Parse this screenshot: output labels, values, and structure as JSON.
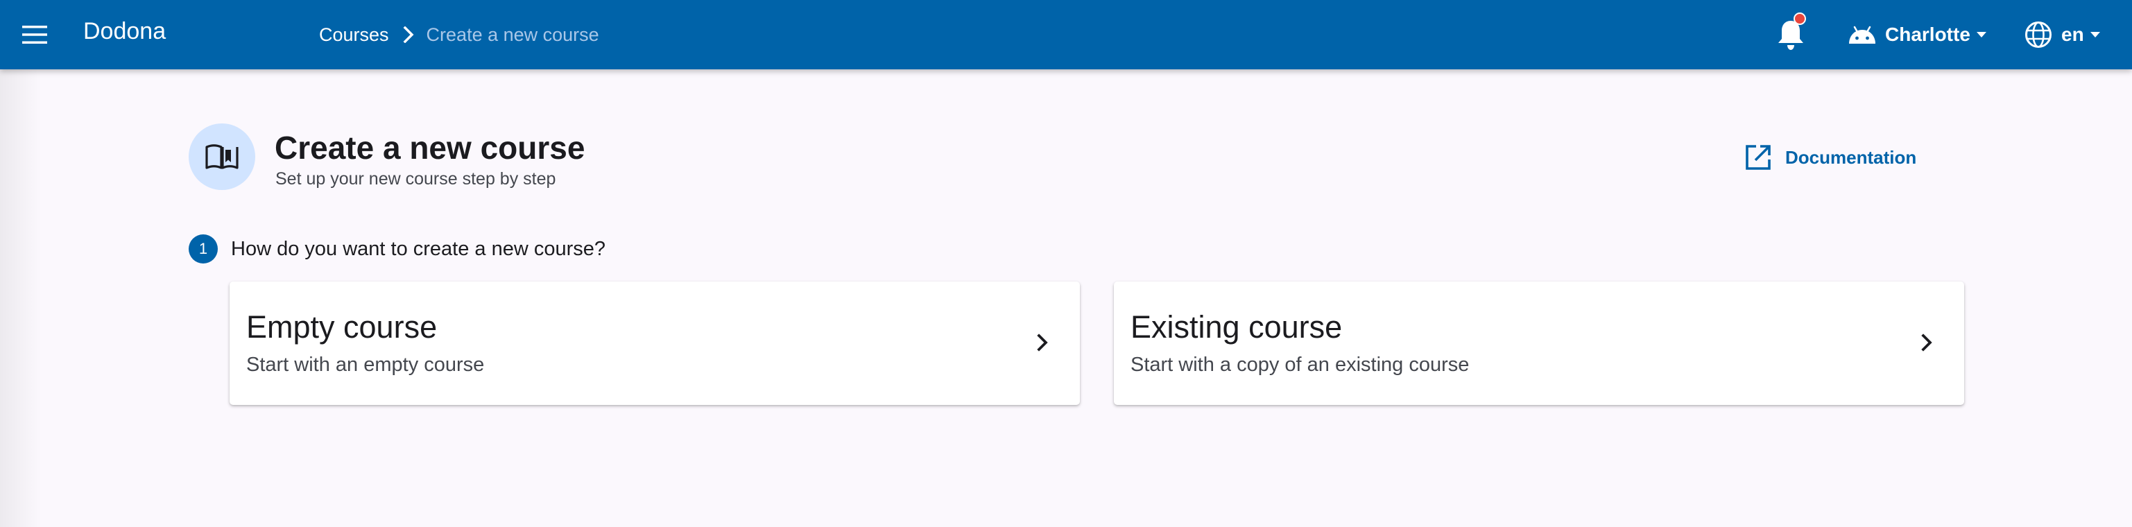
{
  "app": {
    "title": "Dodona"
  },
  "breadcrumb": {
    "root": "Courses",
    "current": "Create a new course"
  },
  "user": {
    "name": "Charlotte"
  },
  "language": {
    "code": "en"
  },
  "notifications": {
    "has_unread": true
  },
  "header": {
    "title": "Create a new course",
    "subtitle": "Set up your new course step by step",
    "documentation_label": "Documentation"
  },
  "step": {
    "number": "1",
    "question": "How do you want to create a new course?"
  },
  "options": [
    {
      "title": "Empty course",
      "description": "Start with an empty course"
    },
    {
      "title": "Existing course",
      "description": "Start with a copy of an existing course"
    }
  ],
  "icons": {
    "menu": "menu-icon",
    "breadcrumb_separator": "chevron-right-icon",
    "notifications": "bell-icon",
    "user": "android-icon",
    "language": "globe-icon",
    "header": "book-open-icon",
    "documentation": "open-in-new-icon",
    "option": "chevron-right-icon"
  },
  "colors": {
    "primary": "#0063a9",
    "background": "#fbf8fd",
    "header_icon_bg": "#d1e4ff",
    "notification_dot": "#e8463d",
    "breadcrumb_muted": "#a9c7e8"
  }
}
